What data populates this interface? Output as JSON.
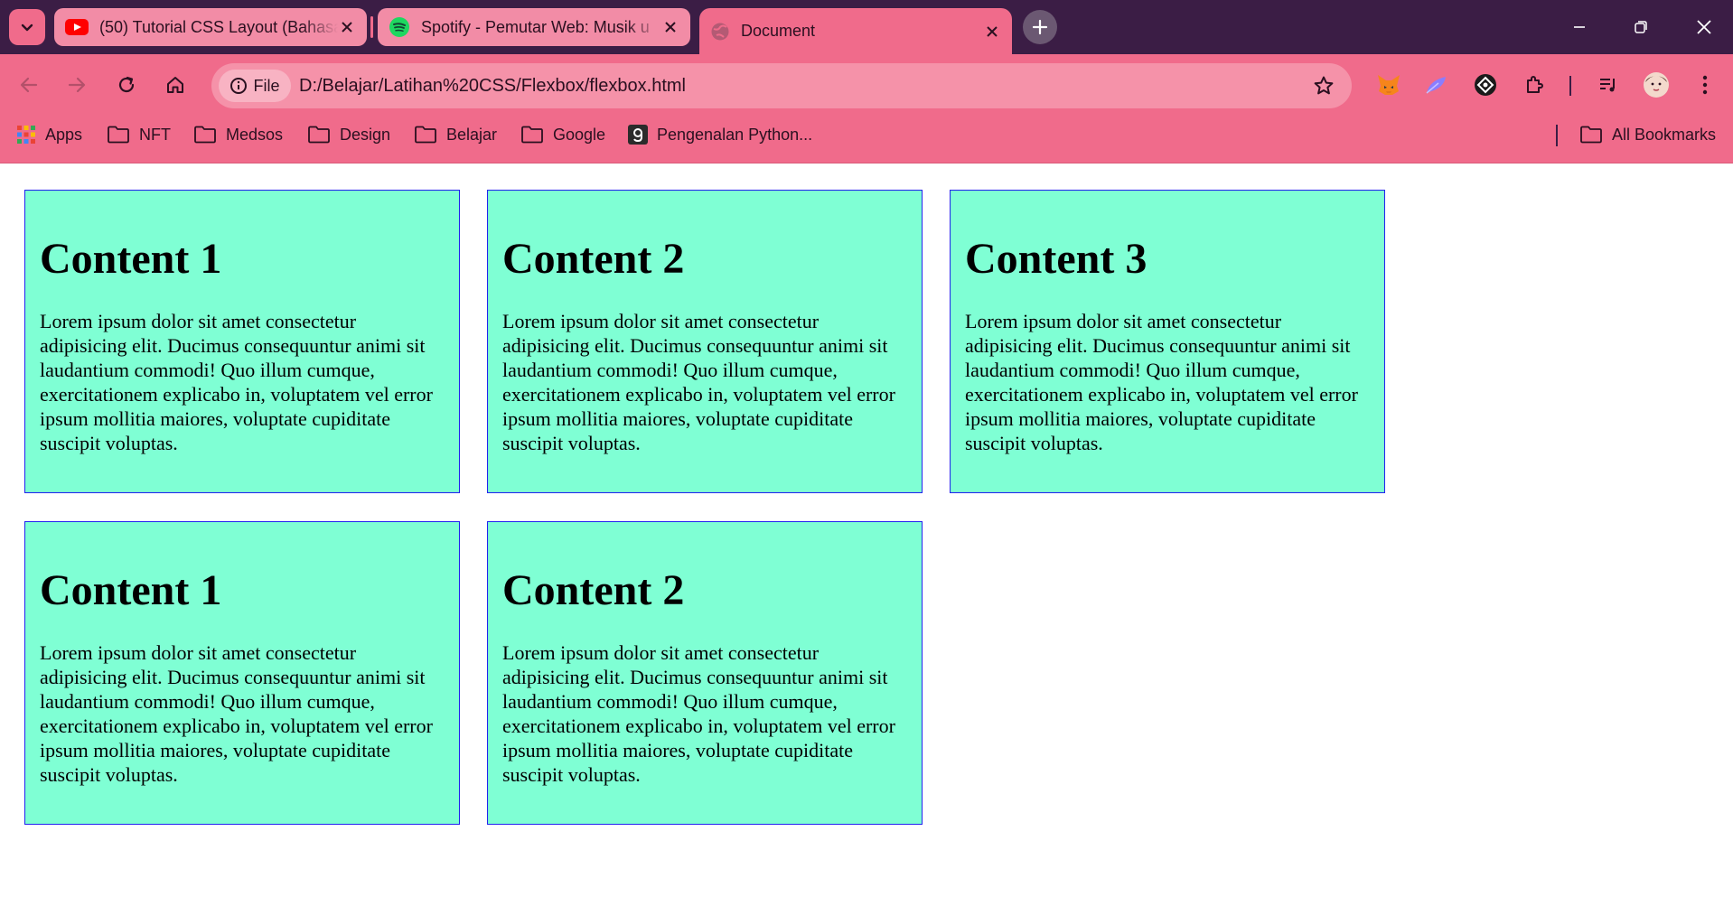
{
  "browser": {
    "tabs": [
      {
        "title": "(50) Tutorial CSS Layout (Bahasa",
        "icon": "youtube-icon"
      },
      {
        "title": "Spotify - Pemutar Web: Musik u",
        "icon": "spotify-icon"
      },
      {
        "title": "Document",
        "icon": "globe-icon",
        "active": true
      }
    ],
    "address": {
      "scheme_label": "File",
      "url": "D:/Belajar/Latihan%20CSS/Flexbox/flexbox.html"
    },
    "bookmarks": [
      {
        "label": "Apps",
        "icon": "apps-grid-icon"
      },
      {
        "label": "NFT",
        "icon": "folder-icon"
      },
      {
        "label": "Medsos",
        "icon": "folder-icon"
      },
      {
        "label": "Design",
        "icon": "folder-icon"
      },
      {
        "label": "Belajar",
        "icon": "folder-icon"
      },
      {
        "label": "Google",
        "icon": "folder-icon"
      },
      {
        "label": "Pengenalan Python...",
        "icon": "site-icon"
      }
    ],
    "all_bookmarks_label": "All Bookmarks",
    "colors": {
      "tabstrip": "#3b1d45",
      "toolbar": "#f06b8b",
      "omnibox": "#f592a9"
    }
  },
  "page": {
    "cards": [
      {
        "heading": "Content 1",
        "text": "Lorem ipsum dolor sit amet consectetur adipisicing elit. Ducimus consequuntur animi sit laudantium commodi! Quo illum cumque, exercitationem explicabo in, voluptatem vel error ipsum mollitia maiores, voluptate cupiditate suscipit voluptas."
      },
      {
        "heading": "Content 2",
        "text": "Lorem ipsum dolor sit amet consectetur adipisicing elit. Ducimus consequuntur animi sit laudantium commodi! Quo illum cumque, exercitationem explicabo in, voluptatem vel error ipsum mollitia maiores, voluptate cupiditate suscipit voluptas."
      },
      {
        "heading": "Content 3",
        "text": "Lorem ipsum dolor sit amet consectetur adipisicing elit. Ducimus consequuntur animi sit laudantium commodi! Quo illum cumque, exercitationem explicabo in, voluptatem vel error ipsum mollitia maiores, voluptate cupiditate suscipit voluptas."
      },
      {
        "heading": "Content 1",
        "text": "Lorem ipsum dolor sit amet consectetur adipisicing elit. Ducimus consequuntur animi sit laudantium commodi! Quo illum cumque, exercitationem explicabo in, voluptatem vel error ipsum mollitia maiores, voluptate cupiditate suscipit voluptas."
      },
      {
        "heading": "Content 2",
        "text": "Lorem ipsum dolor sit amet consectetur adipisicing elit. Ducimus consequuntur animi sit laudantium commodi! Quo illum cumque, exercitationem explicabo in, voluptatem vel error ipsum mollitia maiores, voluptate cupiditate suscipit voluptas."
      }
    ],
    "colors": {
      "card_background": "#7fffd4",
      "card_border": "#2222ee"
    }
  }
}
